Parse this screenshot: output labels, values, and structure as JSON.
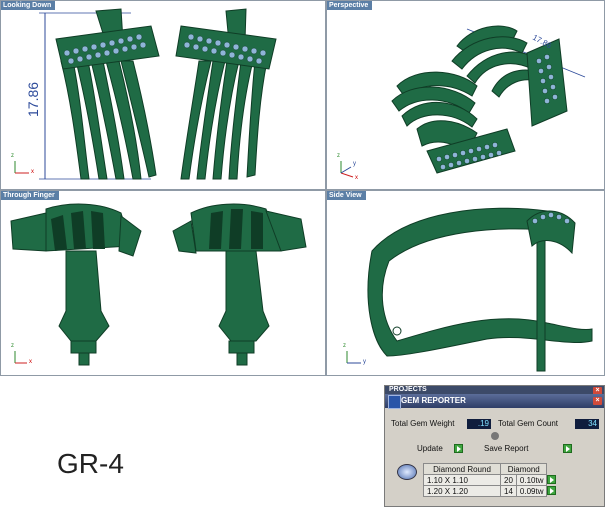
{
  "viewports": {
    "top_left": {
      "title": "Looking Down",
      "dimension": "17.86"
    },
    "top_right": {
      "title": "Perspective",
      "dimension": "17.86"
    },
    "bottom_left": {
      "title": "Through Finger"
    },
    "bottom_right": {
      "title": "Side View"
    }
  },
  "axes": {
    "x": "x",
    "y": "y",
    "z": "z"
  },
  "model_label": "GR-4",
  "gem_reporter": {
    "projects_label": "PROJECTS",
    "title": "GEM REPORTER",
    "total_weight_label": "Total Gem Weight",
    "total_weight": ".19",
    "total_count_label": "Total Gem Count",
    "total_count": "34",
    "update_label": "Update",
    "save_label": "Save Report",
    "table": {
      "headers": [
        "Diamond Round",
        "Diamond"
      ],
      "rows": [
        {
          "size": "1.10 X 1.10",
          "count": "20",
          "weight": "0.10tw"
        },
        {
          "size": "1.20 X 1.20",
          "count": "14",
          "weight": "0.09tw"
        }
      ]
    }
  },
  "colors": {
    "metal": "#1f6b45",
    "metal_dark": "#0f3d26",
    "gem": "#8fb4d8",
    "dimension": "#2c4a9a"
  }
}
